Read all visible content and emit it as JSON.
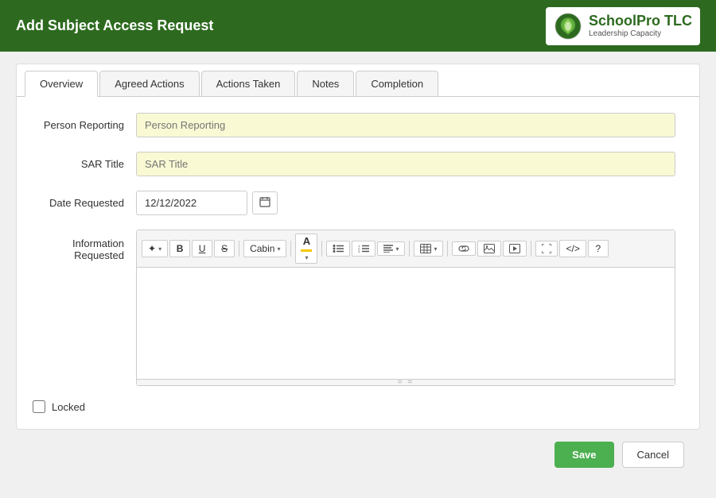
{
  "header": {
    "title": "Add Subject Access Request",
    "logo_text_main": "SchoolPro TLC",
    "logo_text_sub": "Leadership Capacity"
  },
  "tabs": [
    {
      "id": "overview",
      "label": "Overview",
      "active": true
    },
    {
      "id": "agreed-actions",
      "label": "Agreed Actions",
      "active": false
    },
    {
      "id": "actions-taken",
      "label": "Actions Taken",
      "active": false
    },
    {
      "id": "notes",
      "label": "Notes",
      "active": false
    },
    {
      "id": "completion",
      "label": "Completion",
      "active": false
    }
  ],
  "form": {
    "person_reporting_label": "Person Reporting",
    "person_reporting_placeholder": "Person Reporting",
    "sar_title_label": "SAR Title",
    "sar_title_placeholder": "SAR Title",
    "date_requested_label": "Date Requested",
    "date_requested_value": "12/12/2022",
    "information_requested_label": "Information Requested",
    "locked_label": "Locked"
  },
  "toolbar": {
    "buttons": [
      {
        "id": "magic",
        "label": "✦▾",
        "tooltip": "Special"
      },
      {
        "id": "bold",
        "label": "B",
        "tooltip": "Bold"
      },
      {
        "id": "underline",
        "label": "U",
        "tooltip": "Underline"
      },
      {
        "id": "strikethrough",
        "label": "S̶",
        "tooltip": "Strikethrough"
      },
      {
        "id": "font",
        "label": "Cabin ▾",
        "tooltip": "Font"
      },
      {
        "id": "font-color",
        "label": "A",
        "tooltip": "Font Color"
      },
      {
        "id": "unordered-list",
        "label": "≡•",
        "tooltip": "Unordered List"
      },
      {
        "id": "ordered-list",
        "label": "≡1",
        "tooltip": "Ordered List"
      },
      {
        "id": "align",
        "label": "≡▾",
        "tooltip": "Alignment"
      },
      {
        "id": "table",
        "label": "⊞▾",
        "tooltip": "Table"
      },
      {
        "id": "link",
        "label": "🔗",
        "tooltip": "Link"
      },
      {
        "id": "image",
        "label": "🖼",
        "tooltip": "Image"
      },
      {
        "id": "media",
        "label": "▶",
        "tooltip": "Media"
      },
      {
        "id": "fullscreen",
        "label": "⤢",
        "tooltip": "Fullscreen"
      },
      {
        "id": "code",
        "label": "</>",
        "tooltip": "Code"
      },
      {
        "id": "help",
        "label": "?",
        "tooltip": "Help"
      }
    ]
  },
  "footer": {
    "save_label": "Save",
    "cancel_label": "Cancel"
  }
}
